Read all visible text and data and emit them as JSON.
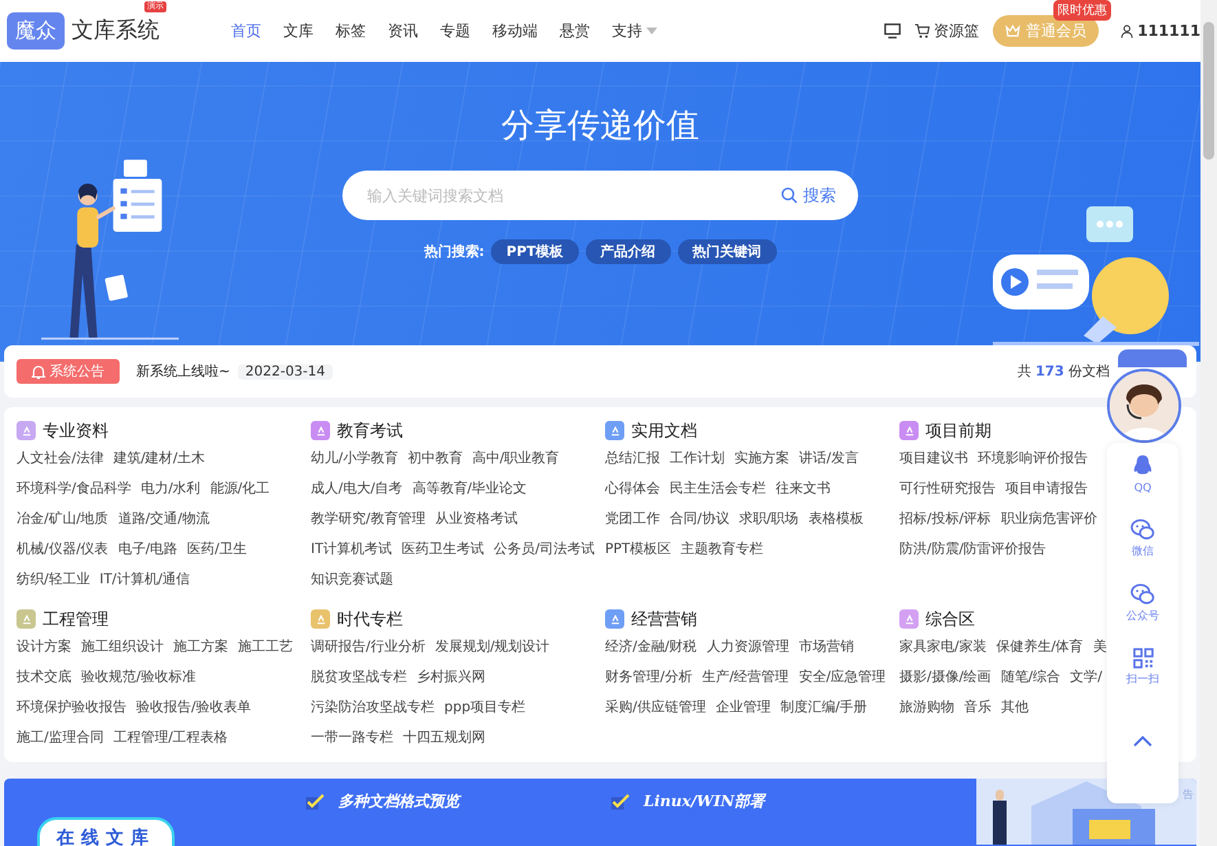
{
  "header": {
    "logo_mark": "魔众",
    "logo_text": "文库系统",
    "logo_badge": "演示",
    "nav": [
      {
        "label": "首页",
        "selected": true,
        "dropdown": false
      },
      {
        "label": "文库",
        "selected": false,
        "dropdown": false
      },
      {
        "label": "标签",
        "selected": false,
        "dropdown": false
      },
      {
        "label": "资讯",
        "selected": false,
        "dropdown": false
      },
      {
        "label": "专题",
        "selected": false,
        "dropdown": false
      },
      {
        "label": "移动端",
        "selected": false,
        "dropdown": false
      },
      {
        "label": "悬赏",
        "selected": false,
        "dropdown": false
      },
      {
        "label": "支持",
        "selected": false,
        "dropdown": true
      }
    ],
    "cart": "资源篮",
    "vip_button": "普通会员",
    "vip_badge": "限时优惠",
    "user": "111111"
  },
  "banner": {
    "title": "分享传递价值",
    "search": {
      "placeholder": "输入关键词搜索文档",
      "button": "搜索"
    },
    "hot_label": "热门搜索:",
    "hot_tags": [
      "PPT模板",
      "产品介绍",
      "热门关键词"
    ]
  },
  "notice": {
    "button": "系统公告",
    "text": "新系统上线啦~",
    "date": "2022-03-14",
    "count_prefix": "共",
    "count": "173",
    "count_suffix": "份文档"
  },
  "categories": [
    {
      "title": "专业资料",
      "color": "#c7a8f2",
      "lines": [
        {
          "links": [
            "人文社会/法律",
            "建筑/建材/土木"
          ]
        },
        {
          "links": [
            "环境科学/食品科学",
            "电力/水利",
            "能源/化工"
          ]
        },
        {
          "links": [
            "冶金/矿山/地质",
            "道路/交通/物流"
          ]
        },
        {
          "links": [
            "机械/仪器/仪表",
            "电子/电路",
            "医药/卫生"
          ]
        },
        {
          "links": [
            "纺织/轻工业",
            "IT/计算机/通信"
          ]
        }
      ]
    },
    {
      "title": "教育考试",
      "color": "#c98cf2",
      "lines": [
        {
          "links": [
            "幼儿/小学教育",
            "初中教育",
            "高中/职业教育"
          ]
        },
        {
          "links": [
            "成人/电大/自考",
            "高等教育/毕业论文"
          ]
        },
        {
          "links": [
            "教学研究/教育管理",
            "从业资格考试"
          ]
        },
        {
          "links": [
            "IT计算机考试",
            "医药卫生考试",
            "公务员/司法考试"
          ]
        },
        {
          "links": [
            "知识竞赛试题"
          ]
        }
      ]
    },
    {
      "title": "实用文档",
      "color": "#6f9ef5",
      "lines": [
        {
          "links": [
            "总结汇报",
            "工作计划",
            "实施方案",
            "讲话/发言"
          ]
        },
        {
          "links": [
            "心得体会",
            "民主生活会专栏",
            "往来文书"
          ]
        },
        {
          "links": [
            "党团工作",
            "合同/协议",
            "求职/职场",
            "表格模板"
          ]
        },
        {
          "links": [
            "PPT模板区",
            "主题教育专栏"
          ]
        }
      ]
    },
    {
      "title": "项目前期",
      "color": "#c98cf2",
      "lines": [
        {
          "links": [
            "项目建议书",
            "环境影响评价报告"
          ]
        },
        {
          "links": [
            "可行性研究报告",
            "项目申请报告"
          ]
        },
        {
          "links": [
            "招标/投标/评标",
            "职业病危害评价"
          ]
        },
        {
          "links": [
            "防洪/防震/防雷评价报告"
          ]
        }
      ]
    },
    {
      "title": "工程管理",
      "color": "#c9c690",
      "lines": [
        {
          "links": [
            "设计方案",
            "施工组织设计",
            "施工方案",
            "施工工艺"
          ]
        },
        {
          "links": [
            "技术交底",
            "验收规范/验收标准"
          ]
        },
        {
          "links": [
            "环境保护验收报告",
            "验收报告/验收表单"
          ]
        },
        {
          "links": [
            "施工/监理合同",
            "工程管理/工程表格"
          ]
        }
      ]
    },
    {
      "title": "时代专栏",
      "color": "#e9c26c",
      "lines": [
        {
          "links": [
            "调研报告/行业分析",
            "发展规划/规划设计"
          ]
        },
        {
          "links": [
            "脱贫攻坚战专栏",
            "乡村振兴网"
          ]
        },
        {
          "links": [
            "污染防治攻坚战专栏",
            "ppp项目专栏"
          ]
        },
        {
          "links": [
            "一带一路专栏",
            "十四五规划网"
          ]
        }
      ]
    },
    {
      "title": "经营营销",
      "color": "#6f9ef5",
      "lines": [
        {
          "links": [
            "经济/金融/财税",
            "人力资源管理",
            "市场营销"
          ]
        },
        {
          "links": [
            "财务管理/分析",
            "生产/经营管理",
            "安全/应急管理"
          ]
        },
        {
          "links": [
            "采购/供应链管理",
            "企业管理",
            "制度汇编/手册"
          ]
        }
      ]
    },
    {
      "title": "综合区",
      "color": "#d3a0f2",
      "lines": [
        {
          "links": [
            "家具家电/家装",
            "保健养生/体育",
            "美"
          ]
        },
        {
          "links": [
            "摄影/摄像/绘画",
            "随笔/综合",
            "文学/"
          ]
        },
        {
          "links": [
            "旅游购物",
            "音乐",
            "其他"
          ]
        }
      ]
    }
  ],
  "side_panel": [
    {
      "kind": "qq",
      "label": "QQ"
    },
    {
      "kind": "wechat",
      "label": "微信"
    },
    {
      "kind": "official",
      "label": "公众号"
    },
    {
      "kind": "scan",
      "label": "扫一扫"
    },
    {
      "kind": "top"
    }
  ],
  "promo": {
    "badge": "在线文库",
    "features": [
      "多种文档格式预览",
      "Linux/WIN部署"
    ],
    "ad_mark": "告"
  }
}
